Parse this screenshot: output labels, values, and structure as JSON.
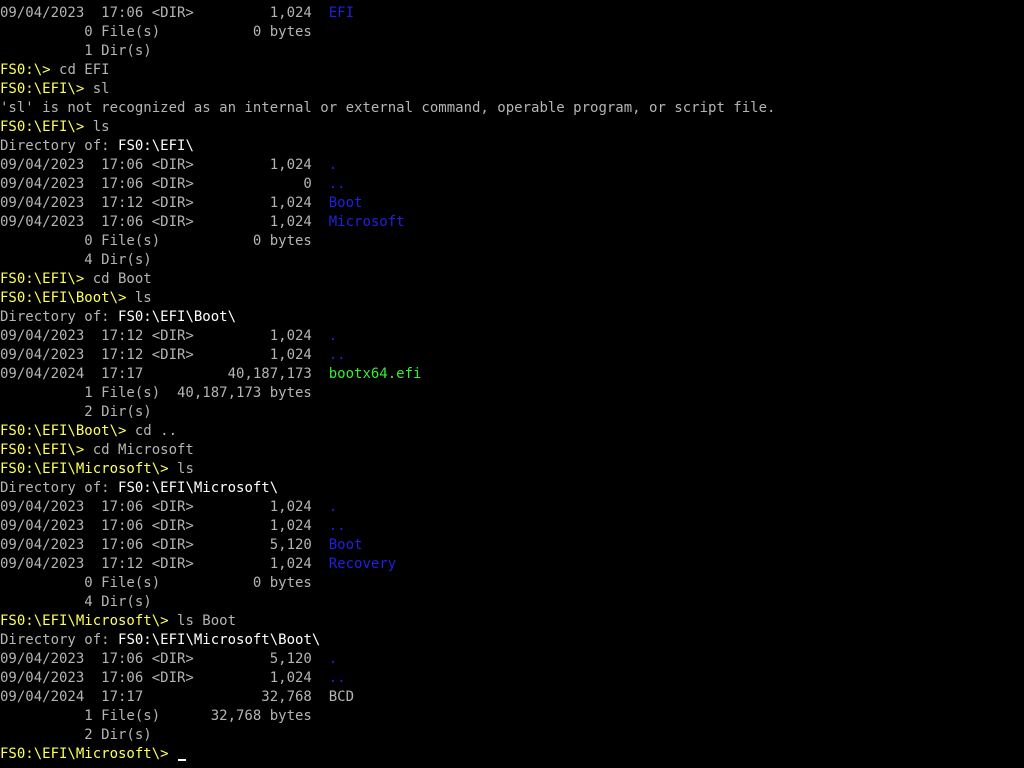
{
  "colors": {
    "background": "#000000",
    "prompt": "#ffff55",
    "text": "#b4b4b4",
    "path": "#ffffff",
    "directory": "#2020e0",
    "executable": "#33ee33"
  },
  "lines": [
    {
      "type": "entry",
      "text": "09/04/2023  17:06 <DIR>         1,024  ",
      "name": "EFI",
      "kind": "dir"
    },
    {
      "type": "text",
      "text": "          0 File(s)           0 bytes"
    },
    {
      "type": "text",
      "text": "          1 Dir(s)"
    },
    {
      "type": "prompt",
      "prompt": "FS0:\\> ",
      "cmd": "cd EFI"
    },
    {
      "type": "prompt",
      "prompt": "FS0:\\EFI\\> ",
      "cmd": "sl"
    },
    {
      "type": "text",
      "text": "'sl' is not recognized as an internal or external command, operable program, or script file."
    },
    {
      "type": "prompt",
      "prompt": "FS0:\\EFI\\> ",
      "cmd": "ls"
    },
    {
      "type": "dirof",
      "label": "Directory of: ",
      "path": "FS0:\\EFI\\"
    },
    {
      "type": "entry",
      "text": "09/04/2023  17:06 <DIR>         1,024  ",
      "name": ".",
      "kind": "dir"
    },
    {
      "type": "entry",
      "text": "09/04/2023  17:06 <DIR>             0  ",
      "name": "..",
      "kind": "dir"
    },
    {
      "type": "entry",
      "text": "09/04/2023  17:12 <DIR>         1,024  ",
      "name": "Boot",
      "kind": "dir"
    },
    {
      "type": "entry",
      "text": "09/04/2023  17:06 <DIR>         1,024  ",
      "name": "Microsoft",
      "kind": "dir"
    },
    {
      "type": "text",
      "text": "          0 File(s)           0 bytes"
    },
    {
      "type": "text",
      "text": "          4 Dir(s)"
    },
    {
      "type": "prompt",
      "prompt": "FS0:\\EFI\\> ",
      "cmd": "cd Boot"
    },
    {
      "type": "prompt",
      "prompt": "FS0:\\EFI\\Boot\\> ",
      "cmd": "ls"
    },
    {
      "type": "dirof",
      "label": "Directory of: ",
      "path": "FS0:\\EFI\\Boot\\"
    },
    {
      "type": "entry",
      "text": "09/04/2023  17:12 <DIR>         1,024  ",
      "name": ".",
      "kind": "dir"
    },
    {
      "type": "entry",
      "text": "09/04/2023  17:12 <DIR>         1,024  ",
      "name": "..",
      "kind": "dir"
    },
    {
      "type": "entry",
      "text": "09/04/2024  17:17          40,187,173  ",
      "name": "bootx64.efi",
      "kind": "exe"
    },
    {
      "type": "text",
      "text": "          1 File(s)  40,187,173 bytes"
    },
    {
      "type": "text",
      "text": "          2 Dir(s)"
    },
    {
      "type": "prompt",
      "prompt": "FS0:\\EFI\\Boot\\> ",
      "cmd": "cd .."
    },
    {
      "type": "prompt",
      "prompt": "FS0:\\EFI\\> ",
      "cmd": "cd Microsoft"
    },
    {
      "type": "prompt",
      "prompt": "FS0:\\EFI\\Microsoft\\> ",
      "cmd": "ls"
    },
    {
      "type": "dirof",
      "label": "Directory of: ",
      "path": "FS0:\\EFI\\Microsoft\\"
    },
    {
      "type": "entry",
      "text": "09/04/2023  17:06 <DIR>         1,024  ",
      "name": ".",
      "kind": "dir"
    },
    {
      "type": "entry",
      "text": "09/04/2023  17:06 <DIR>         1,024  ",
      "name": "..",
      "kind": "dir"
    },
    {
      "type": "entry",
      "text": "09/04/2023  17:06 <DIR>         5,120  ",
      "name": "Boot",
      "kind": "dir"
    },
    {
      "type": "entry",
      "text": "09/04/2023  17:12 <DIR>         1,024  ",
      "name": "Recovery",
      "kind": "dir"
    },
    {
      "type": "text",
      "text": "          0 File(s)           0 bytes"
    },
    {
      "type": "text",
      "text": "          4 Dir(s)"
    },
    {
      "type": "prompt",
      "prompt": "FS0:\\EFI\\Microsoft\\> ",
      "cmd": "ls Boot"
    },
    {
      "type": "dirof",
      "label": "Directory of: ",
      "path": "FS0:\\EFI\\Microsoft\\Boot\\"
    },
    {
      "type": "entry",
      "text": "09/04/2023  17:06 <DIR>         5,120  ",
      "name": ".",
      "kind": "dir"
    },
    {
      "type": "entry",
      "text": "09/04/2023  17:06 <DIR>         1,024  ",
      "name": "..",
      "kind": "dir"
    },
    {
      "type": "entry",
      "text": "09/04/2024  17:17              32,768  ",
      "name": "BCD",
      "kind": "file"
    },
    {
      "type": "text",
      "text": "          1 File(s)      32,768 bytes"
    },
    {
      "type": "text",
      "text": "          2 Dir(s)"
    },
    {
      "type": "current",
      "prompt": "FS0:\\EFI\\Microsoft\\> ",
      "cmd": ""
    }
  ]
}
